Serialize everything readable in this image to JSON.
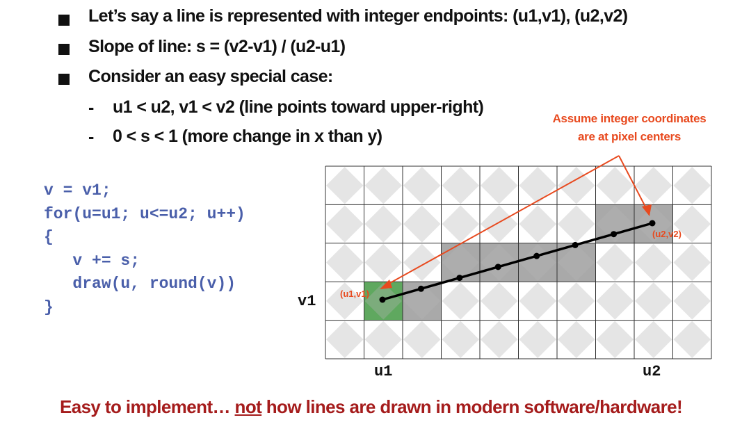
{
  "bullets": [
    "Let’s say a line is represented with integer endpoints: (u1,v1), (u2,v2)",
    "Slope of line: s = (v2-v1) / (u2-u1)",
    "Consider an easy special case:"
  ],
  "sub_bullets": [
    "u1 < u2, v1 < v2 (line points toward upper-right)",
    "0 < s < 1 (more change in x than y)"
  ],
  "dash_symbol": "-",
  "code_lines": [
    "v = v1;",
    "for(u=u1; u<=u2; u++)",
    "{",
    "   v += s;",
    "   draw(u, round(v))",
    "}"
  ],
  "annotation": {
    "line1": "Assume integer coordinates",
    "line2": "are at pixel centers"
  },
  "diagram": {
    "start_label": "(u1,v1)",
    "end_label": "(u2,v2)",
    "v1_label": "v1",
    "u1_label": "u1",
    "u2_label": "u2"
  },
  "footer": {
    "before": "Easy to implement… ",
    "underlined": "not",
    "after": " how lines are drawn in modern software/hardware!"
  },
  "colors": {
    "code": "#4a5faa",
    "annotation": "#e84a1f",
    "footer": "#a51c1c",
    "start_pixel": "#5fa85f",
    "drawn_pixel": "#a9a9a9"
  }
}
